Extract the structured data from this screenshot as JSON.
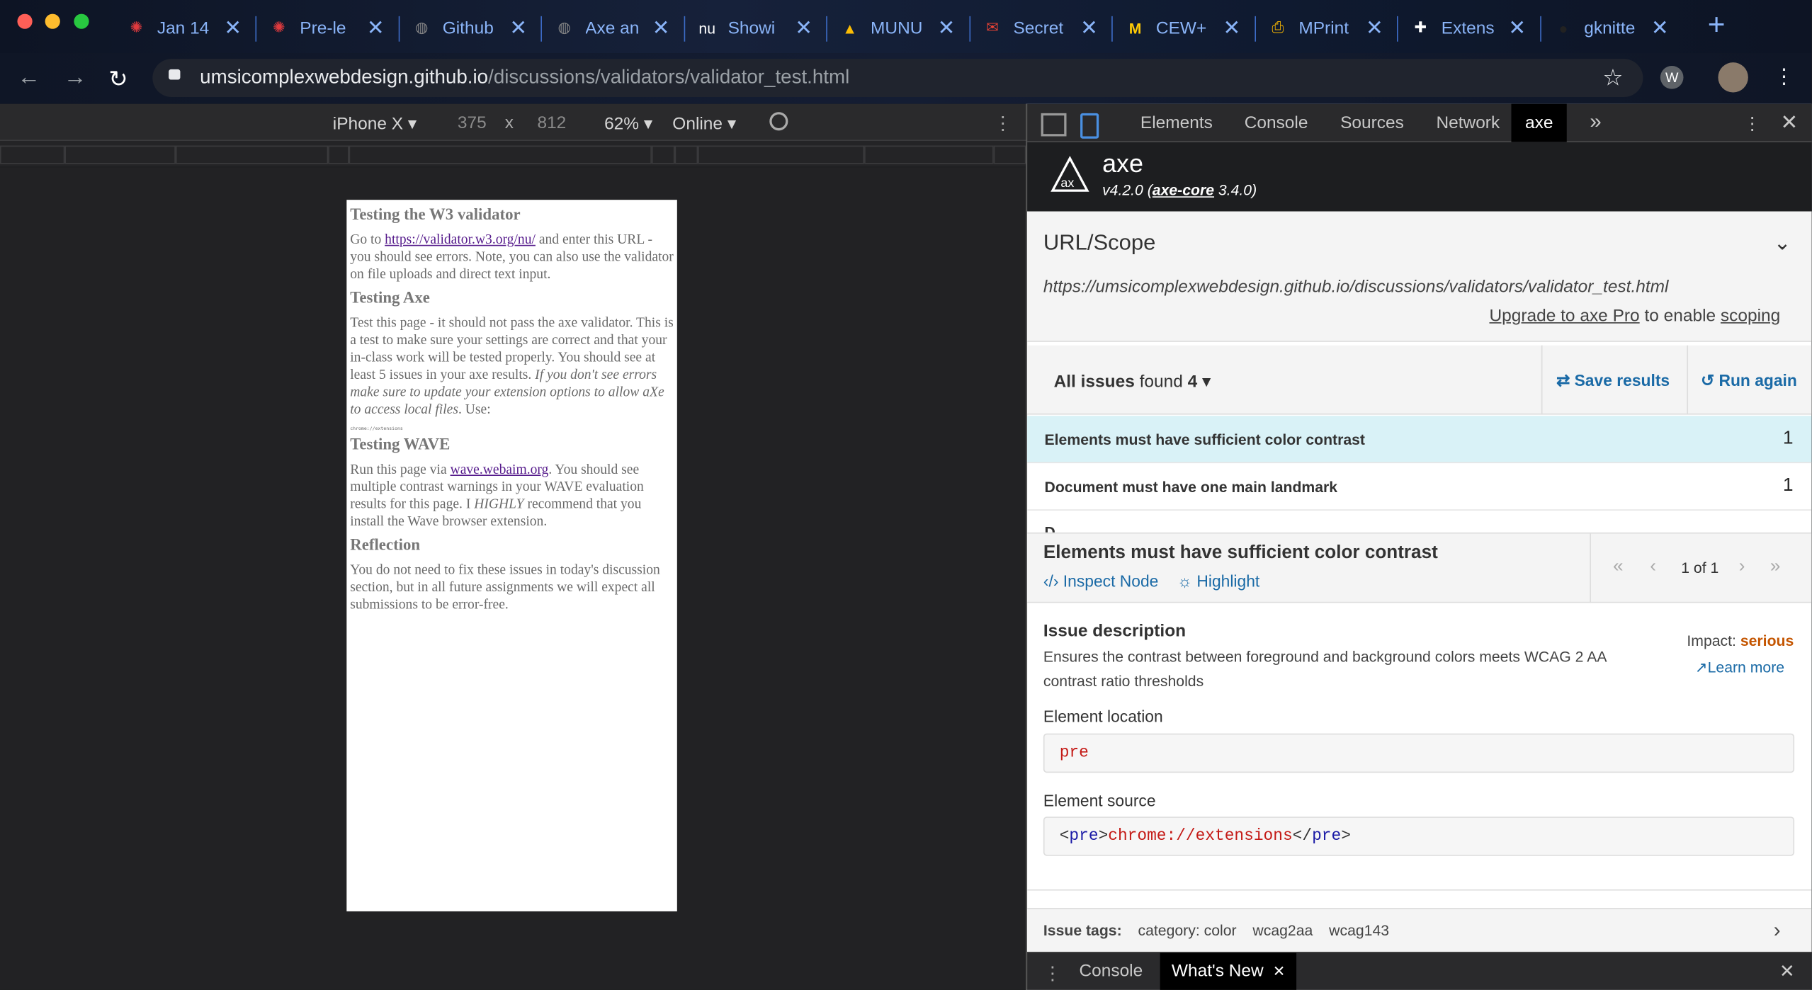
{
  "browser": {
    "tabs": [
      {
        "label": "Jan 14",
        "icon": "canvas-icon"
      },
      {
        "label": "Pre-le",
        "icon": "canvas-icon"
      },
      {
        "label": "Github",
        "icon": "globe-icon"
      },
      {
        "label": "Axe an",
        "icon": "globe-icon"
      },
      {
        "label": "Showi",
        "icon": "nu-icon",
        "icon_text": "nu"
      },
      {
        "label": "MUNU",
        "icon": "drive-icon"
      },
      {
        "label": "Secret",
        "icon": "gmail-icon"
      },
      {
        "label": "CEW+",
        "icon": "michigan-icon",
        "icon_text": "M"
      },
      {
        "label": "MPrint",
        "icon": "printer-icon"
      },
      {
        "label": "Extens",
        "icon": "puzzle-icon"
      },
      {
        "label": "gknitte",
        "icon": "github-icon"
      }
    ],
    "url_host": "umsicomplexwebdesign.github.io",
    "url_path": "/discussions/validators/validator_test.html",
    "accent": "#8ab4f8"
  },
  "device_toolbar": {
    "device": "iPhone X",
    "width": "375",
    "times": "x",
    "height": "812",
    "zoom": "62%",
    "network": "Online"
  },
  "page": {
    "h1": "Testing the W3 validator",
    "p1_pre": "Go to ",
    "p1_link": "https://validator.w3.org/nu/",
    "p1_post": " and enter this URL - you should see errors. Note, you can also use the validator on file uploads and direct text input.",
    "h2": "Testing Axe",
    "p2": "Test this page - it should not pass the axe validator. This is a test to make sure your settings are correct and that your in-class work will be tested properly. You should see at least 5 issues in your axe results. ",
    "p2_em": "If you don't see errors make sure to update your extension options to allow aXe to access local files",
    "p2_end": ". Use:",
    "pre": "chrome://extensions",
    "h3": "Testing WAVE",
    "p3_pre": "Run this page via ",
    "p3_link": "wave.webaim.org",
    "p3_mid": ". You should see multiple contrast warnings in your WAVE evaluation results for this page. I ",
    "p3_em": "HIGHLY",
    "p3_post": " recommend that you install the Wave browser extension.",
    "h4": "Reflection",
    "p4": "You do not need to fix these issues in today's discussion section, but in all future assignments we will expect all submissions to be error-free."
  },
  "devtools": {
    "tabs": [
      "Elements",
      "Console",
      "Sources",
      "Network",
      "axe"
    ],
    "active_tab": "axe",
    "more": "»"
  },
  "axe": {
    "name": "axe",
    "version_pre": "v4.2.0 (",
    "core_link": "axe-core",
    "version_post": " 3.4.0)",
    "scope_title": "URL/Scope",
    "scope_url": "https://umsicomplexwebdesign.github.io/discussions/validators/validator_test.html",
    "upgrade_link": "Upgrade to axe Pro",
    "upgrade_text": " to enable ",
    "scoping_link": "scoping",
    "issues_label": "All issues",
    "found_label": " found ",
    "found_count": "4",
    "save_label": "Save results",
    "run_label": "Run again",
    "issues": [
      {
        "title": "Elements must have sufficient color contrast",
        "count": "1"
      },
      {
        "title": "Document must have one main landmark",
        "count": "1"
      }
    ],
    "detail_title": "Elements must have sufficient color contrast",
    "inspect_label": "Inspect Node",
    "highlight_label": "Highlight",
    "pager": "1 of 1",
    "desc_title": "Issue description",
    "desc_text": "Ensures the contrast between foreground and background colors meets WCAG 2 AA contrast ratio thresholds",
    "impact_label": "Impact: ",
    "impact_value": "serious",
    "learn_more": "Learn more",
    "location_title": "Element location",
    "location_value": "pre",
    "source_title": "Element source",
    "source_lt": "<",
    "source_tag": "pre",
    "source_gt": ">",
    "source_text": "chrome://extensions",
    "source_close_lt": "</",
    "tags_label": "Issue tags:",
    "tags": [
      "category: color",
      "wcag2aa",
      "wcag143"
    ],
    "highlight_color": "#d9f2f7",
    "link_color": "#1a6aa6",
    "serious_color": "#c45500"
  },
  "drawer": {
    "tabs": [
      "Console",
      "What's New"
    ],
    "active": "What's New"
  }
}
